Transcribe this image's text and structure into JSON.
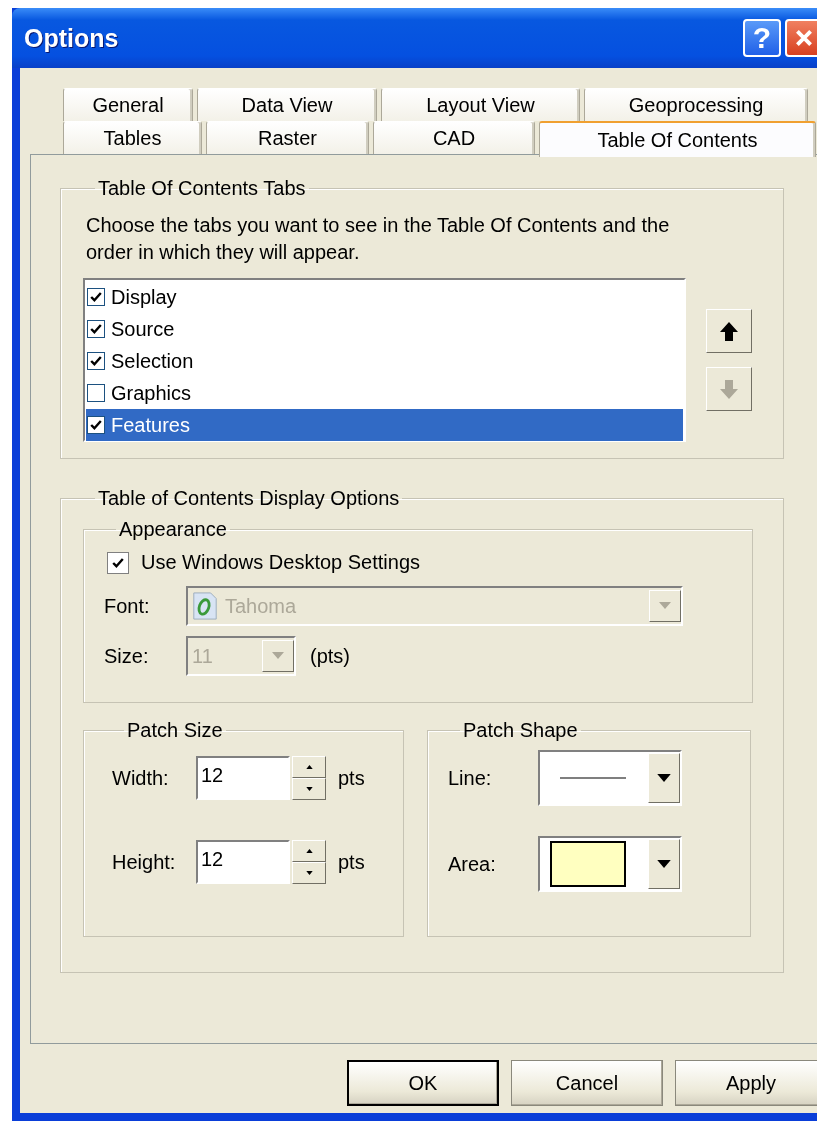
{
  "window": {
    "title": "Options",
    "help_button": "?"
  },
  "tabs": {
    "rows": [
      [
        {
          "label": "General",
          "selected": false
        },
        {
          "label": "Data View",
          "selected": false
        },
        {
          "label": "Layout View",
          "selected": false
        },
        {
          "label": "Geoprocessing",
          "selected": false
        }
      ],
      [
        {
          "label": "Tables",
          "selected": false
        },
        {
          "label": "Raster",
          "selected": false
        },
        {
          "label": "CAD",
          "selected": false
        },
        {
          "label": "Table Of Contents",
          "selected": true
        }
      ]
    ]
  },
  "toc_tabs": {
    "title": "Table Of Contents Tabs",
    "description": "Choose the tabs you want to see in the Table Of Contents and the order in which they will appear.",
    "items": [
      {
        "label": "Display",
        "checked": true,
        "selected": false
      },
      {
        "label": "Source",
        "checked": true,
        "selected": false
      },
      {
        "label": "Selection",
        "checked": true,
        "selected": false
      },
      {
        "label": "Graphics",
        "checked": false,
        "selected": false
      },
      {
        "label": "Features",
        "checked": true,
        "selected": true
      }
    ],
    "move_buttons": [
      {
        "kind": "up",
        "disabled": false
      },
      {
        "kind": "down",
        "disabled": true
      }
    ]
  },
  "display_options": {
    "title": "Table of Contents Display Options",
    "appearance": {
      "title": "Appearance",
      "use_desktop_settings": {
        "label": "Use Windows Desktop Settings",
        "checked": true
      },
      "font": {
        "label": "Font:",
        "value": "Tahoma",
        "disabled": true
      },
      "size": {
        "label": "Size:",
        "value": "11",
        "unit": "(pts)",
        "disabled": true
      }
    },
    "patch_size": {
      "title": "Patch Size",
      "fields": [
        {
          "label": "Width:",
          "value": "12",
          "unit": "pts"
        },
        {
          "label": "Height:",
          "value": "12",
          "unit": "pts"
        }
      ]
    },
    "patch_shape": {
      "title": "Patch Shape",
      "fields": [
        {
          "label": "Line:",
          "kind": "line"
        },
        {
          "label": "Area:",
          "kind": "area"
        }
      ]
    }
  },
  "buttons": [
    {
      "label": "OK",
      "default": true
    },
    {
      "label": "Cancel",
      "default": false
    },
    {
      "label": "Apply",
      "default": false
    }
  ]
}
